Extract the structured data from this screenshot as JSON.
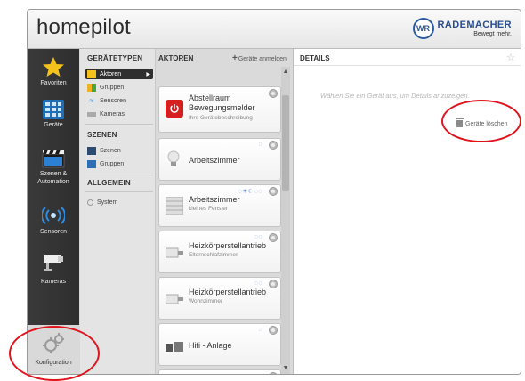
{
  "header": {
    "app_title": "homepilot",
    "brand_badge": "WR",
    "brand_name": "RADEMACHER",
    "brand_slogan": "Bewegt mehr."
  },
  "nav": {
    "favoriten": "Favoriten",
    "geraete": "Geräte",
    "szenen": "Szenen &",
    "automation": "Automation",
    "sensoren": "Sensoren",
    "kameras": "Kameras",
    "konfiguration": "Konfiguration"
  },
  "categories": {
    "geraetetypen_title": "GERÄTETYPEN",
    "aktoren": "Aktoren",
    "gruppen": "Gruppen",
    "sensoren": "Sensoren",
    "kameras": "Kameras",
    "szenen_title": "SZENEN",
    "szenen": "Szenen",
    "szenen_gruppen": "Gruppen",
    "allgemein_title": "ALLGEMEIN",
    "system": "System"
  },
  "aktoren": {
    "title": "AKTOREN",
    "add_link": "Geräte anmelden",
    "add_plus": "+",
    "devices": [
      {
        "name_line1": "Abstellraum",
        "name_line2": "Bewegungsmelder",
        "desc": "Ihre Gerätebeschreibung"
      },
      {
        "name_line1": "Arbeitszimmer",
        "name_line2": "",
        "desc": ""
      },
      {
        "name_line1": "Arbeitszimmer",
        "name_line2": "",
        "desc": "kleines Fenster"
      },
      {
        "name_line1": "Heizkörperstellantrieb",
        "name_line2": "",
        "desc": "Elternschlafzimmer"
      },
      {
        "name_line1": "Heizkörperstellantrieb",
        "name_line2": "",
        "desc": "Wohnzimmer"
      },
      {
        "name_line1": "Hifi - Anlage",
        "name_line2": "",
        "desc": ""
      }
    ]
  },
  "details": {
    "title": "DETAILS",
    "hint": "Wählen Sie ein Gerät aus, um Details anzuzeigen.",
    "delete_label": "Geräte löschen"
  },
  "colors": {
    "accent_red": "#e0141e",
    "brand_blue": "#2a5aa0",
    "power_red": "#d62020",
    "status_blue": "#5a8fd0"
  }
}
